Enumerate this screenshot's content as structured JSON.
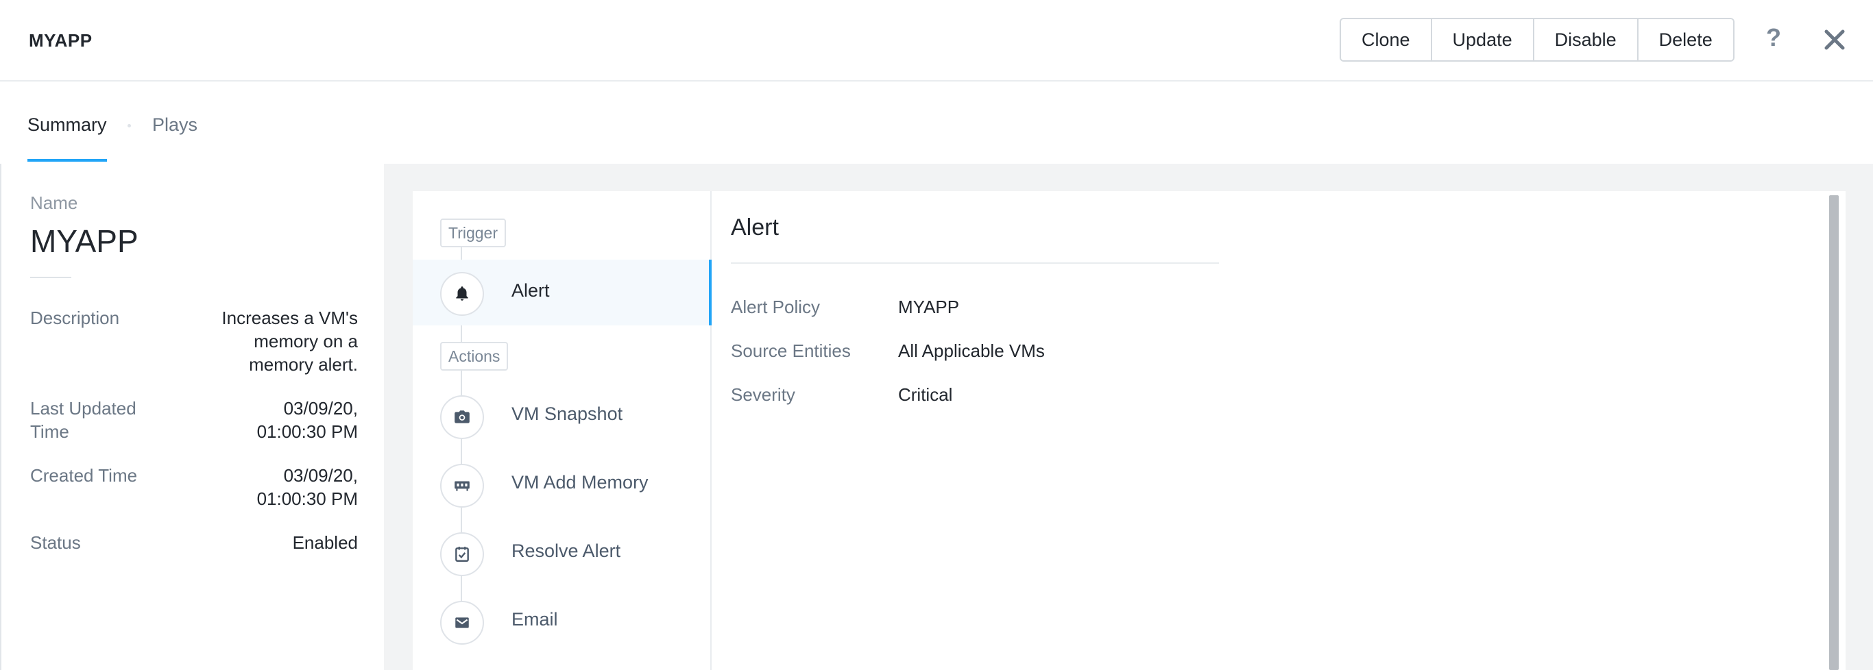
{
  "header": {
    "title": "MYAPP",
    "buttons": {
      "clone": "Clone",
      "update": "Update",
      "disable": "Disable",
      "delete": "Delete"
    },
    "help": "?"
  },
  "tabs": {
    "summary": "Summary",
    "plays": "Plays"
  },
  "summary": {
    "name_label": "Name",
    "name_value": "MYAPP",
    "rows": [
      {
        "label": "Description",
        "value": "Increases a VM's memory on a memory alert."
      },
      {
        "label": "Last Updated Time",
        "value": "03/09/20, 01:00:30 PM"
      },
      {
        "label": "Created Time",
        "value": "03/09/20, 01:00:30 PM"
      },
      {
        "label": "Status",
        "value": "Enabled"
      }
    ]
  },
  "flow": {
    "trigger_tag": "Trigger",
    "actions_tag": "Actions",
    "items": [
      {
        "label": "Alert",
        "icon": "bell-icon"
      },
      {
        "label": "VM Snapshot",
        "icon": "camera-icon"
      },
      {
        "label": "VM Add Memory",
        "icon": "memory-icon"
      },
      {
        "label": "Resolve Alert",
        "icon": "calendar-check-icon"
      },
      {
        "label": "Email",
        "icon": "envelope-icon"
      }
    ]
  },
  "detail": {
    "title": "Alert",
    "fields": [
      {
        "label": "Alert Policy",
        "value": "MYAPP"
      },
      {
        "label": "Source Entities",
        "value": "All Applicable VMs"
      },
      {
        "label": "Severity",
        "value": "Critical"
      }
    ]
  },
  "colors": {
    "accent": "#22a5f7",
    "icon": "#4c5a6b"
  }
}
